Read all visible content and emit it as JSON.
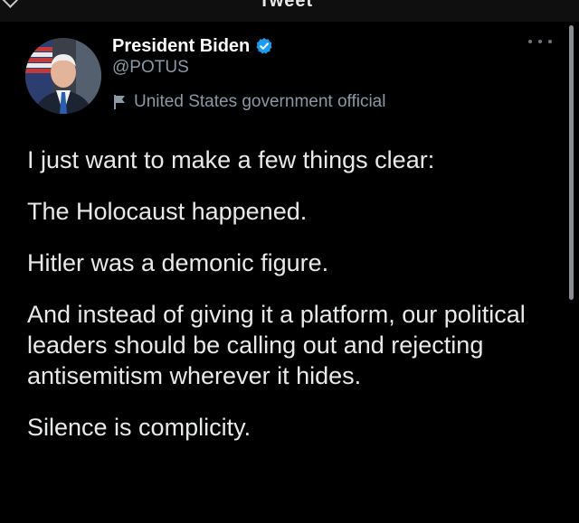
{
  "header": {
    "back_icon": "chevron-left-icon",
    "title_stub": "Tweet"
  },
  "author": {
    "display_name": "President Biden",
    "handle": "@POTUS",
    "verified_icon": "verified-badge-icon",
    "verified_color": "#1d9bf0",
    "label_icon": "flag-icon",
    "label": "United States government official"
  },
  "more_icon": "more-horizontal-icon",
  "tweet": {
    "paragraphs": [
      "I just want to make a few things clear:",
      "The Holocaust happened.",
      "Hitler was a demonic figure.",
      "And instead of giving it a platform, our political leaders should be calling out and rejecting antisemitism wherever it hides.",
      "Silence is complicity."
    ]
  },
  "colors": {
    "background": "#000000",
    "text": "#e7e9ea",
    "secondary_text": "#8b98a5"
  }
}
